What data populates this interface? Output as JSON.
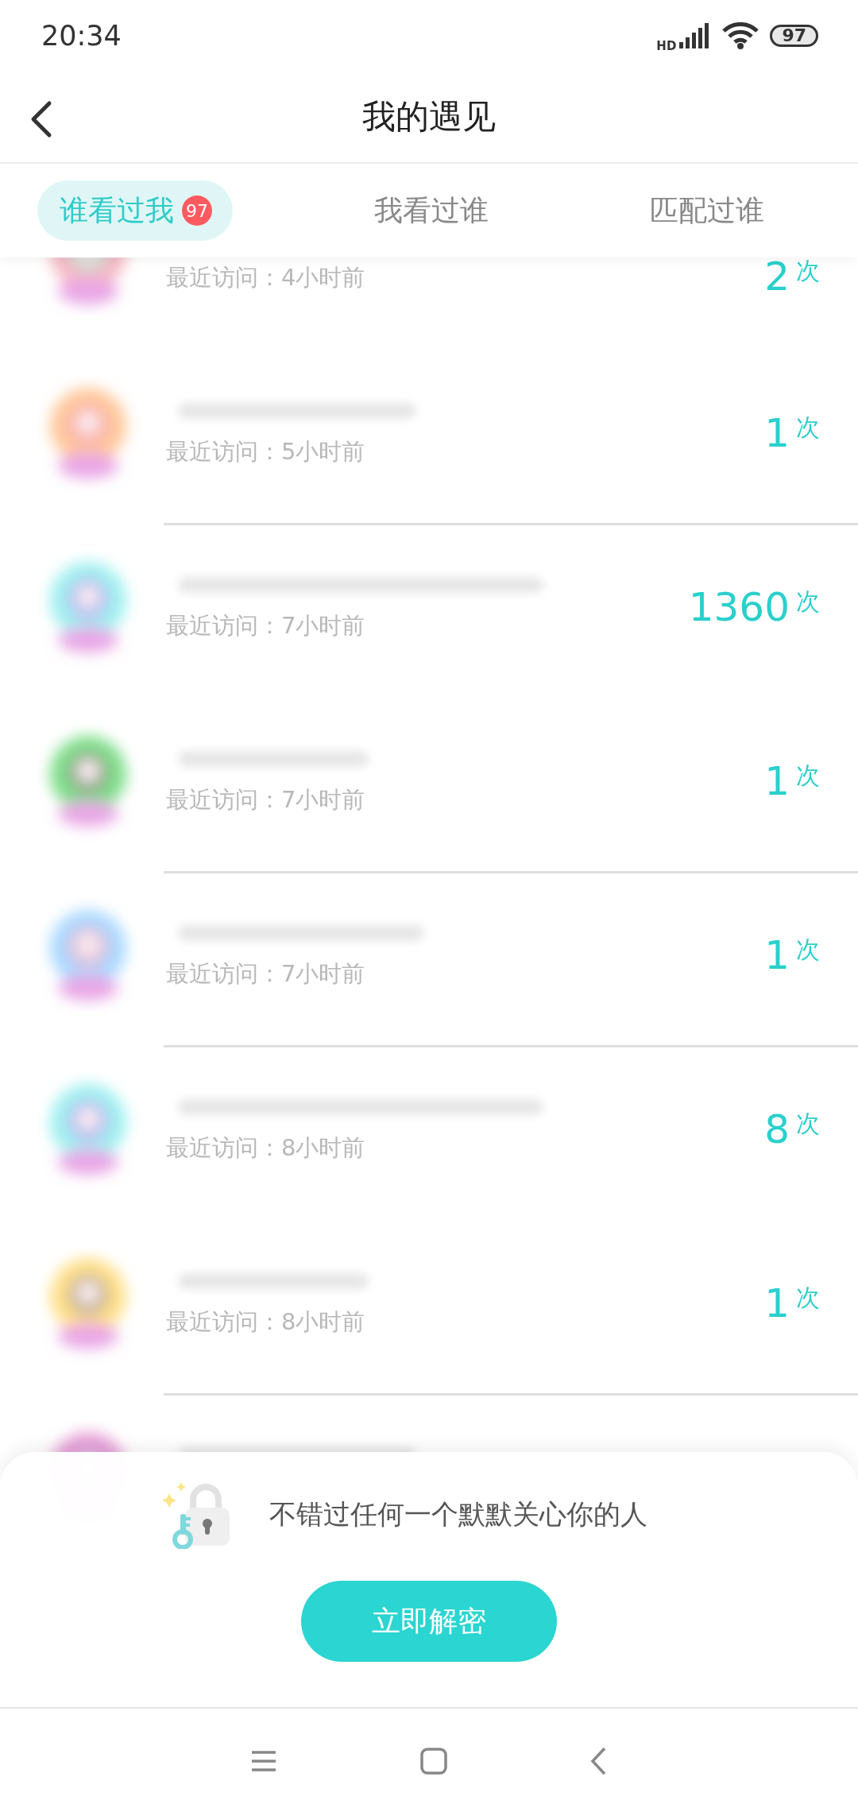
{
  "status_bar": {
    "time": "20:34",
    "network_label": "HD",
    "battery": "97"
  },
  "header": {
    "title": "我的遇见"
  },
  "tabs": [
    {
      "label": "谁看过我",
      "badge": "97",
      "selected": true
    },
    {
      "label": "我看过谁",
      "selected": false
    },
    {
      "label": "匹配过谁",
      "selected": false
    }
  ],
  "visitors": [
    {
      "kind": "visitor",
      "last_visit": "最近访问：4小时前",
      "count": "2",
      "unit": "次",
      "divider_below": false
    },
    {
      "kind": "visitor",
      "last_visit": "最近访问：5小时前",
      "count": "1",
      "unit": "次",
      "divider_below": true
    },
    {
      "kind": "visitor",
      "last_visit": "最近访问：7小时前",
      "count": "1360",
      "unit": "次",
      "divider_below": false
    },
    {
      "kind": "visitor",
      "last_visit": "最近访问：7小时前",
      "count": "1",
      "unit": "次",
      "divider_below": true
    },
    {
      "kind": "visitor",
      "last_visit": "最近访问：7小时前",
      "count": "1",
      "unit": "次",
      "divider_below": true
    },
    {
      "kind": "visitor",
      "last_visit": "最近访问：8小时前",
      "count": "8",
      "unit": "次",
      "divider_below": false
    },
    {
      "kind": "visitor",
      "last_visit": "最近访问：8小时前",
      "count": "1",
      "unit": "次",
      "divider_below": true
    },
    {
      "kind": "partial"
    }
  ],
  "unlock_panel": {
    "message": "不错过任何一个默默关心你的人",
    "button": "立即解密"
  }
}
